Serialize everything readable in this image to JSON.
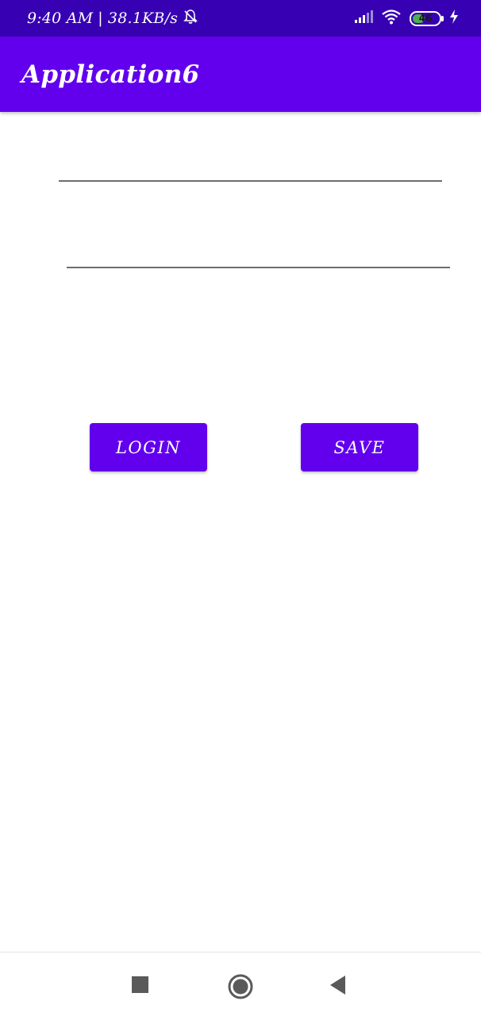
{
  "status_bar": {
    "time": "9:40 AM",
    "separator": "|",
    "net_speed": "38.1KB/s",
    "battery_level": "46",
    "icons": [
      "alarm-off-icon",
      "signal-icon",
      "wifi-icon",
      "battery-icon",
      "charging-icon"
    ]
  },
  "app_bar": {
    "title": "Application6"
  },
  "form": {
    "field1_value": "",
    "field2_value": ""
  },
  "buttons": {
    "login_label": "LOGIN",
    "save_label": "SAVE"
  },
  "nav_bar": {
    "icons": [
      "recents-icon",
      "home-icon",
      "back-icon"
    ]
  },
  "colors": {
    "status_bar": "#3700b3",
    "primary": "#6200ee",
    "battery_fill": "#4caf50"
  }
}
